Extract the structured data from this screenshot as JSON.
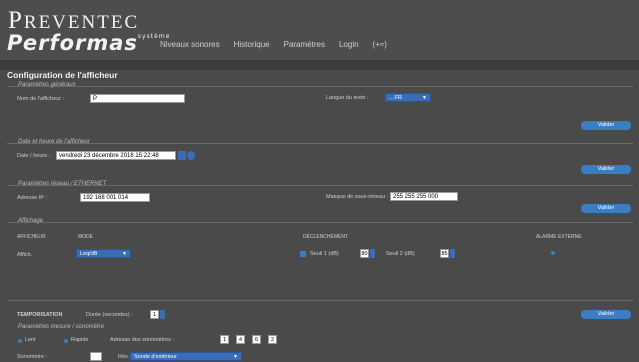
{
  "logo": {
    "line1_cap": "P",
    "line1_rest": "REVENTEC",
    "line2": "Performas",
    "line2_sup": "système"
  },
  "nav": [
    "Niveaux sonores",
    "Historique",
    "Paramètres",
    "Login",
    "(+≈)"
  ],
  "page_title": "Configuration de l'afficheur",
  "general": {
    "legend": "Paramètres généraux",
    "name_label": "Nom de l'afficheur :",
    "name_value": "P",
    "lang_label": "Langue du texte :",
    "lang_value": "…FR",
    "validate": "Valider"
  },
  "datetime": {
    "legend": "Date et heure de l'afficheur",
    "label": "Date / heure :",
    "value": "vendredi 23 décembre 2016 15:22:48",
    "validate": "Valider"
  },
  "network": {
    "legend": "Paramètres réseau / ETHERNET",
    "ip_label": "Adresse IP :",
    "ip_value": "192 168 001 014",
    "mask_label": "Masque de sous-réseau :",
    "mask_value": "255 255 255 000",
    "validate": "Valider"
  },
  "display": {
    "legend": "Affichage",
    "headers": [
      "AFFICHEUR",
      "MODE",
      "DÉCLENCHEMENT",
      "ALARME EXTERNE"
    ],
    "row_label": "Affich.",
    "mode_value": "Leq/dB",
    "seuil1_label": "Seuil 1 (dB)",
    "seuil1_value": "80",
    "seuil2_label": "Seuil 2 (dB)",
    "seuil2_value": "85"
  },
  "web": {
    "label": "TEMPORISATION",
    "sub_label": "Durée (secondes) :",
    "value": "1",
    "validate": "Valider"
  },
  "measure": {
    "legend": "Paramètres mesure / sonomètre",
    "radio1": "Lent",
    "radio2": "Rapide",
    "digits_label": "Adresse des sonomètres :",
    "digits": [
      "1",
      "4",
      "6",
      "2"
    ]
  },
  "bottom": {
    "label1": "Sonomètre :",
    "value1": "",
    "label2": "Rés :",
    "select_value": "Sonde d'extérieur"
  }
}
